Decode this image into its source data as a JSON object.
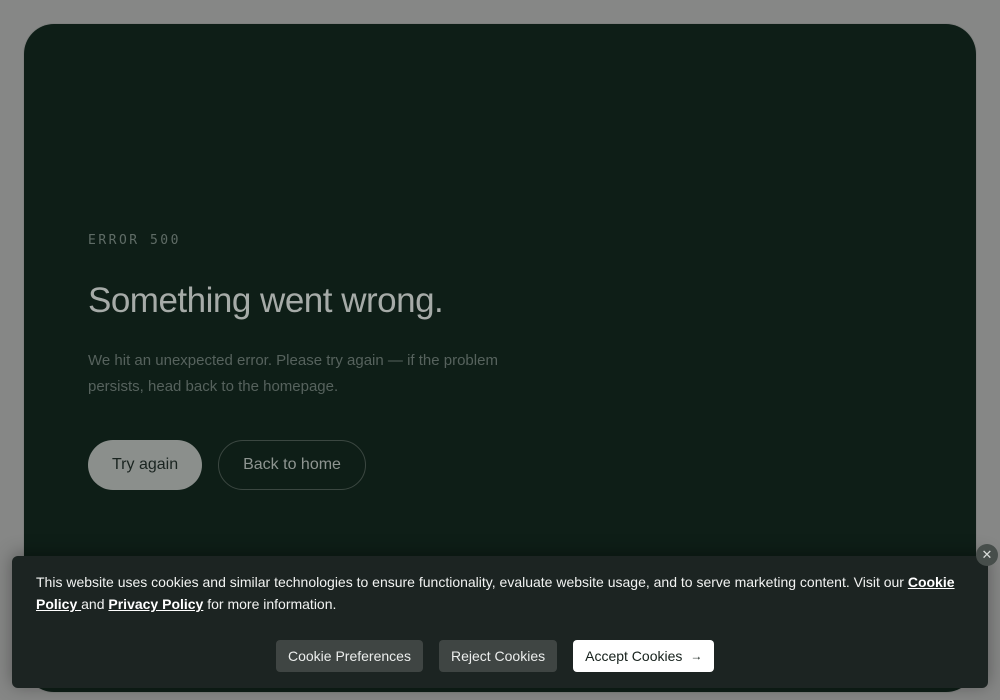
{
  "error": {
    "code_label": "ERROR 500",
    "title": "Something went wrong.",
    "description": "We hit an unexpected error. Please try again — if the problem persists, head back to the homepage.",
    "primary_button": "Try again",
    "secondary_button": "Back to home"
  },
  "cookie_banner": {
    "text_before": "This website uses cookies and similar technologies to ensure functionality, evaluate website usage, and to serve marketing content. Visit our ",
    "cookie_policy_link": "Cookie Policy ",
    "text_and": "and ",
    "privacy_policy_link": "Privacy Policy",
    "text_after": " for more information.",
    "preferences_button": "Cookie Preferences",
    "reject_button": "Reject Cookies",
    "accept_button": "Accept Cookies",
    "accept_icon": "arrow-right-icon",
    "close_icon": "close-icon"
  },
  "colors": {
    "card_background": "#0e1e17",
    "page_background": "#868786",
    "banner_background": "#1c2422"
  }
}
